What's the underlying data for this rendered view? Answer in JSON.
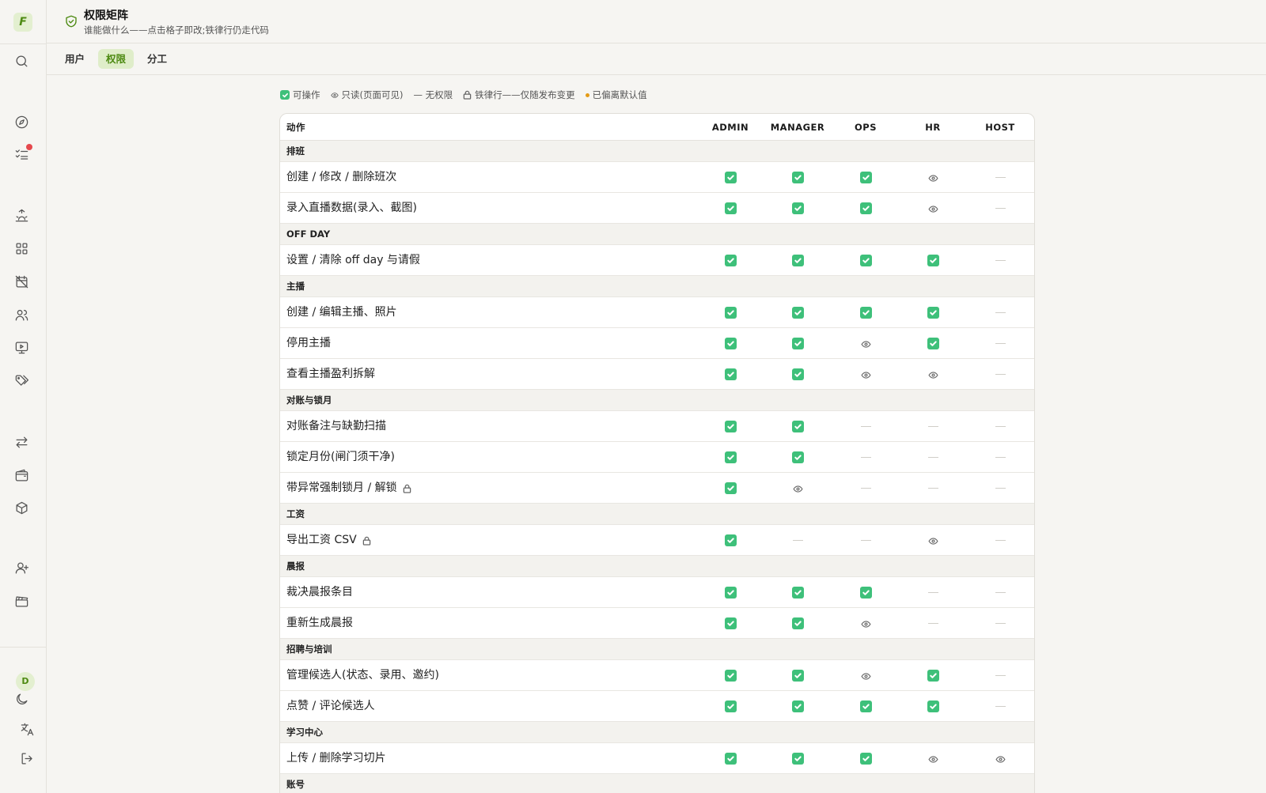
{
  "sidebar": {
    "logo": "F",
    "icons": [
      "search-icon",
      "compass-icon",
      "checklist-icon",
      "sunrise-icon",
      "grid-icon",
      "calendar-off-icon",
      "users-icon",
      "monitor-play-icon",
      "tags-icon",
      "transfer-icon",
      "wallet-icon",
      "package-icon",
      "user-plus-icon",
      "clapperboard-icon"
    ],
    "avatar": "D",
    "bottom_icons": [
      "moon-icon",
      "translate-icon",
      "logout-icon"
    ]
  },
  "header": {
    "title": "权限矩阵",
    "subtitle": "谁能做什么——点击格子即改;铁律行仍走代码"
  },
  "tabs": [
    {
      "label": "用户",
      "active": false
    },
    {
      "label": "权限",
      "active": true
    },
    {
      "label": "分工",
      "active": false
    }
  ],
  "legend": {
    "allowed": "可操作",
    "readonly": "只读(页面可见)",
    "none": "— 无权限",
    "locked": "铁律行——仅随发布变更",
    "deviated": "已偏离默认值"
  },
  "table": {
    "action_header": "动作",
    "roles": [
      "ADMIN",
      "MANAGER",
      "OPS",
      "HR",
      "HOST"
    ],
    "rows": [
      {
        "type": "section",
        "label": "排班"
      },
      {
        "type": "action",
        "label": "创建 / 修改 / 删除班次",
        "locked": false,
        "cells": [
          "y",
          "y",
          "y",
          "r",
          "n"
        ]
      },
      {
        "type": "action",
        "label": "录入直播数据(录入、截图)",
        "locked": false,
        "cells": [
          "y",
          "y",
          "y",
          "r",
          "n"
        ]
      },
      {
        "type": "section",
        "label": "OFF DAY"
      },
      {
        "type": "action",
        "label": "设置 / 清除 off day 与请假",
        "locked": false,
        "cells": [
          "y",
          "y",
          "y",
          "y",
          "n"
        ]
      },
      {
        "type": "section",
        "label": "主播"
      },
      {
        "type": "action",
        "label": "创建 / 编辑主播、照片",
        "locked": false,
        "cells": [
          "y",
          "y",
          "y",
          "y",
          "n"
        ]
      },
      {
        "type": "action",
        "label": "停用主播",
        "locked": false,
        "cells": [
          "y",
          "y",
          "r",
          "y",
          "n"
        ]
      },
      {
        "type": "action",
        "label": "查看主播盈利拆解",
        "locked": false,
        "cells": [
          "y",
          "y",
          "r",
          "r",
          "n"
        ]
      },
      {
        "type": "section",
        "label": "对账与锁月"
      },
      {
        "type": "action",
        "label": "对账备注与缺勤扫描",
        "locked": false,
        "cells": [
          "y",
          "y",
          "n",
          "n",
          "n"
        ]
      },
      {
        "type": "action",
        "label": "锁定月份(闸门须干净)",
        "locked": false,
        "cells": [
          "y",
          "y",
          "n",
          "n",
          "n"
        ]
      },
      {
        "type": "action",
        "label": "带异常强制锁月 / 解锁",
        "locked": true,
        "cells": [
          "y",
          "r",
          "n",
          "n",
          "n"
        ]
      },
      {
        "type": "section",
        "label": "工资"
      },
      {
        "type": "action",
        "label": "导出工资 CSV",
        "locked": true,
        "cells": [
          "y",
          "n",
          "n",
          "r",
          "n"
        ]
      },
      {
        "type": "section",
        "label": "晨报"
      },
      {
        "type": "action",
        "label": "裁决晨报条目",
        "locked": false,
        "cells": [
          "y",
          "y",
          "y",
          "n",
          "n"
        ]
      },
      {
        "type": "action",
        "label": "重新生成晨报",
        "locked": false,
        "cells": [
          "y",
          "y",
          "r",
          "n",
          "n"
        ]
      },
      {
        "type": "section",
        "label": "招聘与培训"
      },
      {
        "type": "action",
        "label": "管理候选人(状态、录用、邀约)",
        "locked": false,
        "cells": [
          "y",
          "y",
          "r",
          "y",
          "n"
        ]
      },
      {
        "type": "action",
        "label": "点赞 / 评论候选人",
        "locked": false,
        "cells": [
          "y",
          "y",
          "y",
          "y",
          "n"
        ]
      },
      {
        "type": "section",
        "label": "学习中心"
      },
      {
        "type": "action",
        "label": "上传 / 删除学习切片",
        "locked": false,
        "cells": [
          "y",
          "y",
          "y",
          "r",
          "r"
        ]
      },
      {
        "type": "section",
        "label": "账号"
      }
    ]
  },
  "colors": {
    "accent": "#4d8a12",
    "accent_bg": "#dfedc9",
    "check": "#3ec07a",
    "deviated_dot": "#e49b16"
  }
}
